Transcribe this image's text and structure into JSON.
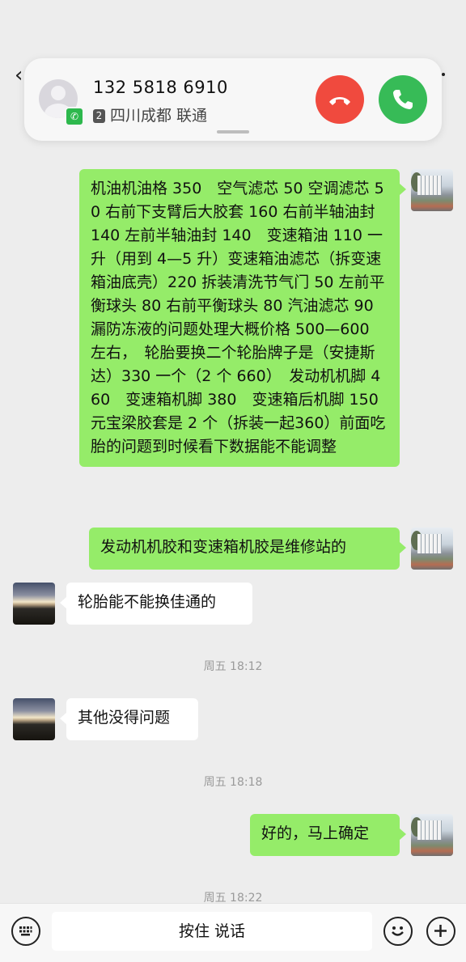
{
  "call": {
    "number": "132 5818 6910",
    "sim": "2",
    "location": "四川成都 联通"
  },
  "messages": {
    "m1": "机油机油格 350　空气滤芯 50 空调滤芯 50 右前下支臂后大胶套 160 右前半轴油封 140 左前半轴油封 140　变速箱油 110 一升（用到 4—5 升）变速箱油滤芯（拆变速箱油底壳）220 拆装清洗节气门 50 左前平衡球头 80 右前平衡球头 80 汽油滤芯 90　漏防冻液的问题处理大概价格 500—600 左右，　轮胎要换二个轮胎牌子是（安捷斯达）330 一个（2 个 660）　发动机机脚 460　变速箱机脚 380　变速箱后机脚 150　　元宝梁胶套是 2 个（拆装一起360）前面吃胎的问题到时候看下数据能不能调整",
    "m2": "发动机机胶和变速箱机胶是维修站的",
    "m3": "轮胎能不能换佳通的",
    "t1": "周五 18:12",
    "m4": "其他没得问题",
    "t2": "周五 18:18",
    "m5": "好的，马上确定",
    "t3": "周五 18:22"
  },
  "input": {
    "hold_to_talk": "按住 说话"
  },
  "colors": {
    "sent_bubble": "#95ec69",
    "received_bubble": "#ffffff",
    "decline": "#f04a3e",
    "accept": "#37bb57"
  }
}
